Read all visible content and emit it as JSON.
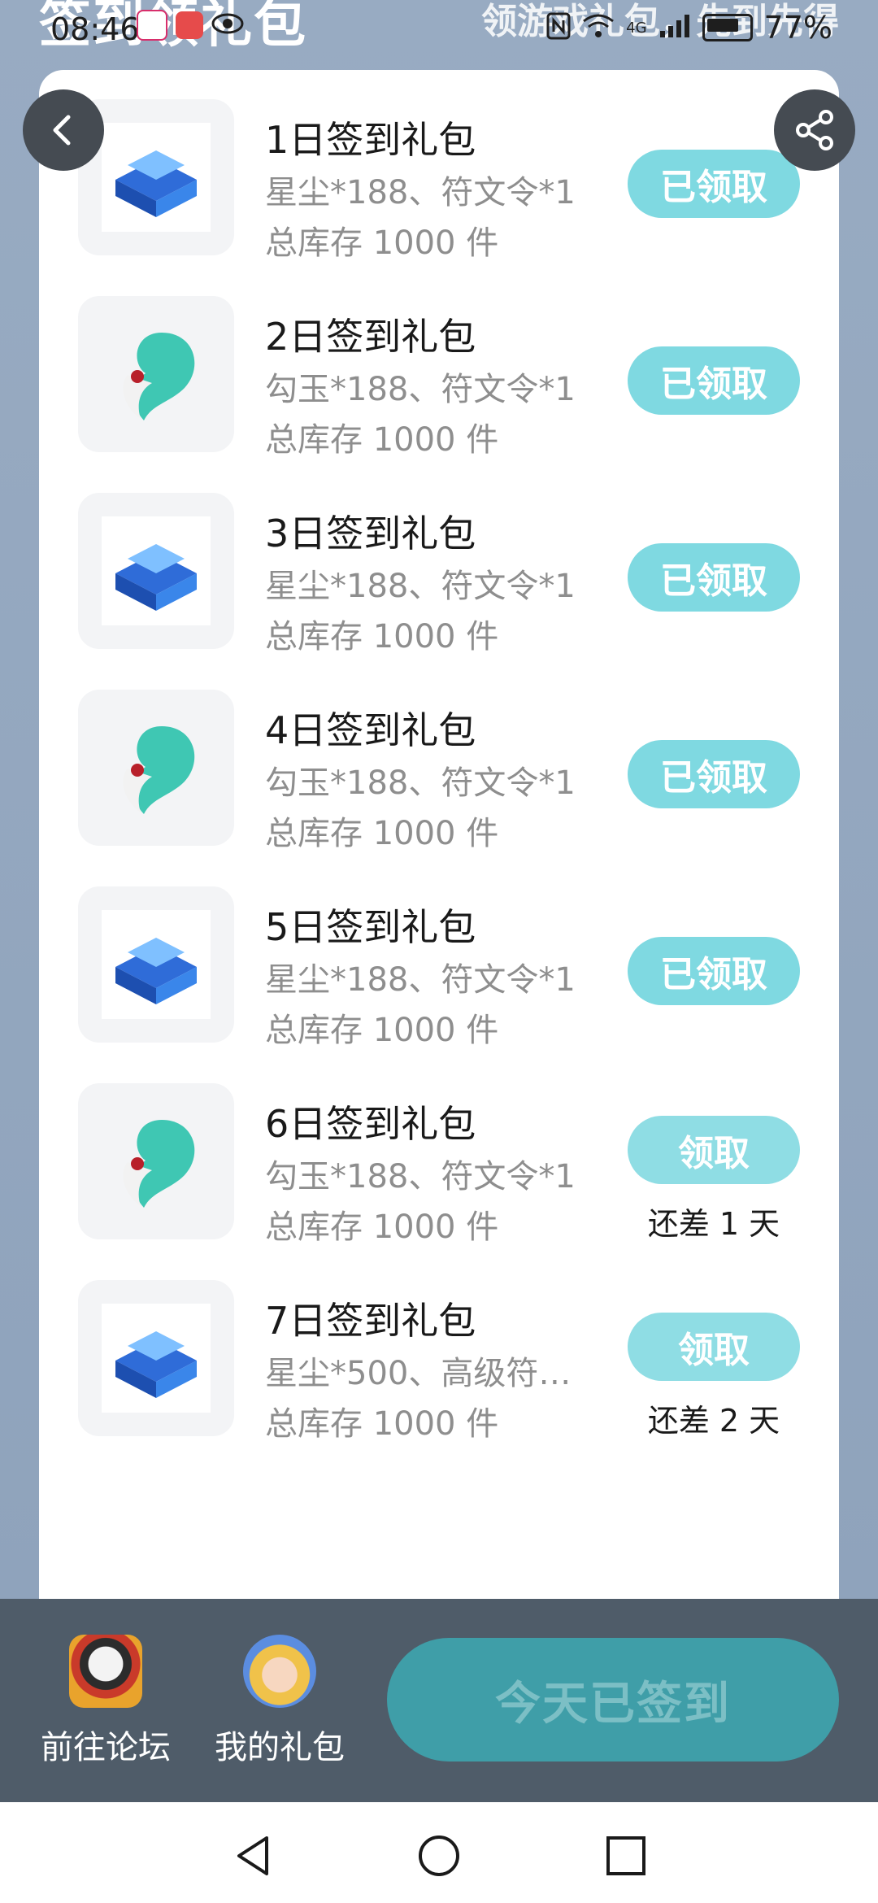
{
  "background": {
    "title": "签到领礼包",
    "slogan": "领游戏礼包，先到先得"
  },
  "status_bar": {
    "time": "08:46",
    "battery": "77%",
    "network": "4G"
  },
  "gifts": [
    {
      "name": "1日签到礼包",
      "desc": "星尘*188、符文令*1",
      "stock": "总库存 1000 件",
      "icon": "blue-chest-icon",
      "button": "已领取",
      "state": "claimed"
    },
    {
      "name": "2日签到礼包",
      "desc": "勾玉*188、符文令*1",
      "stock": "总库存 1000 件",
      "icon": "jade-magatama-icon",
      "button": "已领取",
      "state": "claimed"
    },
    {
      "name": "3日签到礼包",
      "desc": "星尘*188、符文令*1",
      "stock": "总库存 1000 件",
      "icon": "blue-chest-icon",
      "button": "已领取",
      "state": "claimed"
    },
    {
      "name": "4日签到礼包",
      "desc": "勾玉*188、符文令*1",
      "stock": "总库存 1000 件",
      "icon": "jade-magatama-icon",
      "button": "已领取",
      "state": "claimed"
    },
    {
      "name": "5日签到礼包",
      "desc": "星尘*188、符文令*1",
      "stock": "总库存 1000 件",
      "icon": "blue-chest-icon",
      "button": "已领取",
      "state": "claimed"
    },
    {
      "name": "6日签到礼包",
      "desc": "勾玉*188、符文令*1",
      "stock": "总库存 1000 件",
      "icon": "jade-magatama-icon",
      "button": "领取",
      "remain": "还差 1 天",
      "state": "pending"
    },
    {
      "name": "7日签到礼包",
      "desc": "星尘*500、高级符…",
      "stock": "总库存 1000 件",
      "icon": "blue-chest-icon",
      "button": "领取",
      "remain": "还差 2 天",
      "state": "pending"
    }
  ],
  "bottom_bar": {
    "forum_label": "前往论坛",
    "my_gifts_label": "我的礼包",
    "checkin_label": "今天已签到"
  },
  "colors": {
    "claimed_button": "#7fd9e1",
    "checkin_button": "#3f9ea8",
    "bottom_bar": "#4f5c69"
  }
}
